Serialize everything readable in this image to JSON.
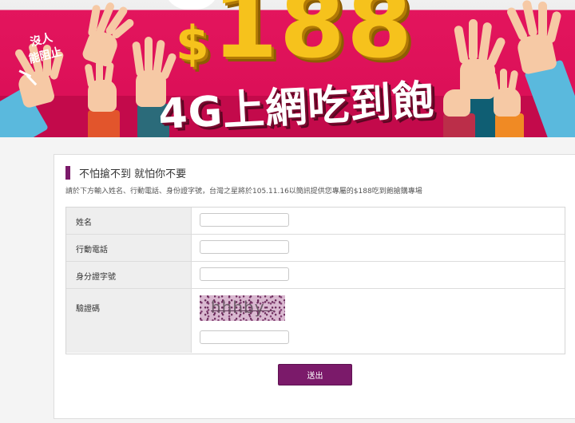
{
  "banner": {
    "badge_line1": "沒人",
    "badge_line2": "能阻止",
    "price_symbol": "$",
    "price_amount": "188",
    "headline": "4G上網吃到飽"
  },
  "form": {
    "section_title": "不怕搶不到 就怕你不要",
    "intro": "請於下方輸入姓名、行動電話、身份證字號，台灣之星將於105.11.16以簡訊提供您專屬的$188吃到飽搶購專場",
    "fields": [
      {
        "label": "姓名",
        "value": ""
      },
      {
        "label": "行動電話",
        "value": ""
      },
      {
        "label": "身分證字號",
        "value": ""
      }
    ],
    "captcha_label": "驗證碼",
    "captcha_image_text": "hhhby",
    "captcha_value": "",
    "submit_label": "送出"
  },
  "colors": {
    "accent": "#7b1a6a",
    "banner_pink": "#e3155d",
    "price_gold": "#f6c21c"
  }
}
